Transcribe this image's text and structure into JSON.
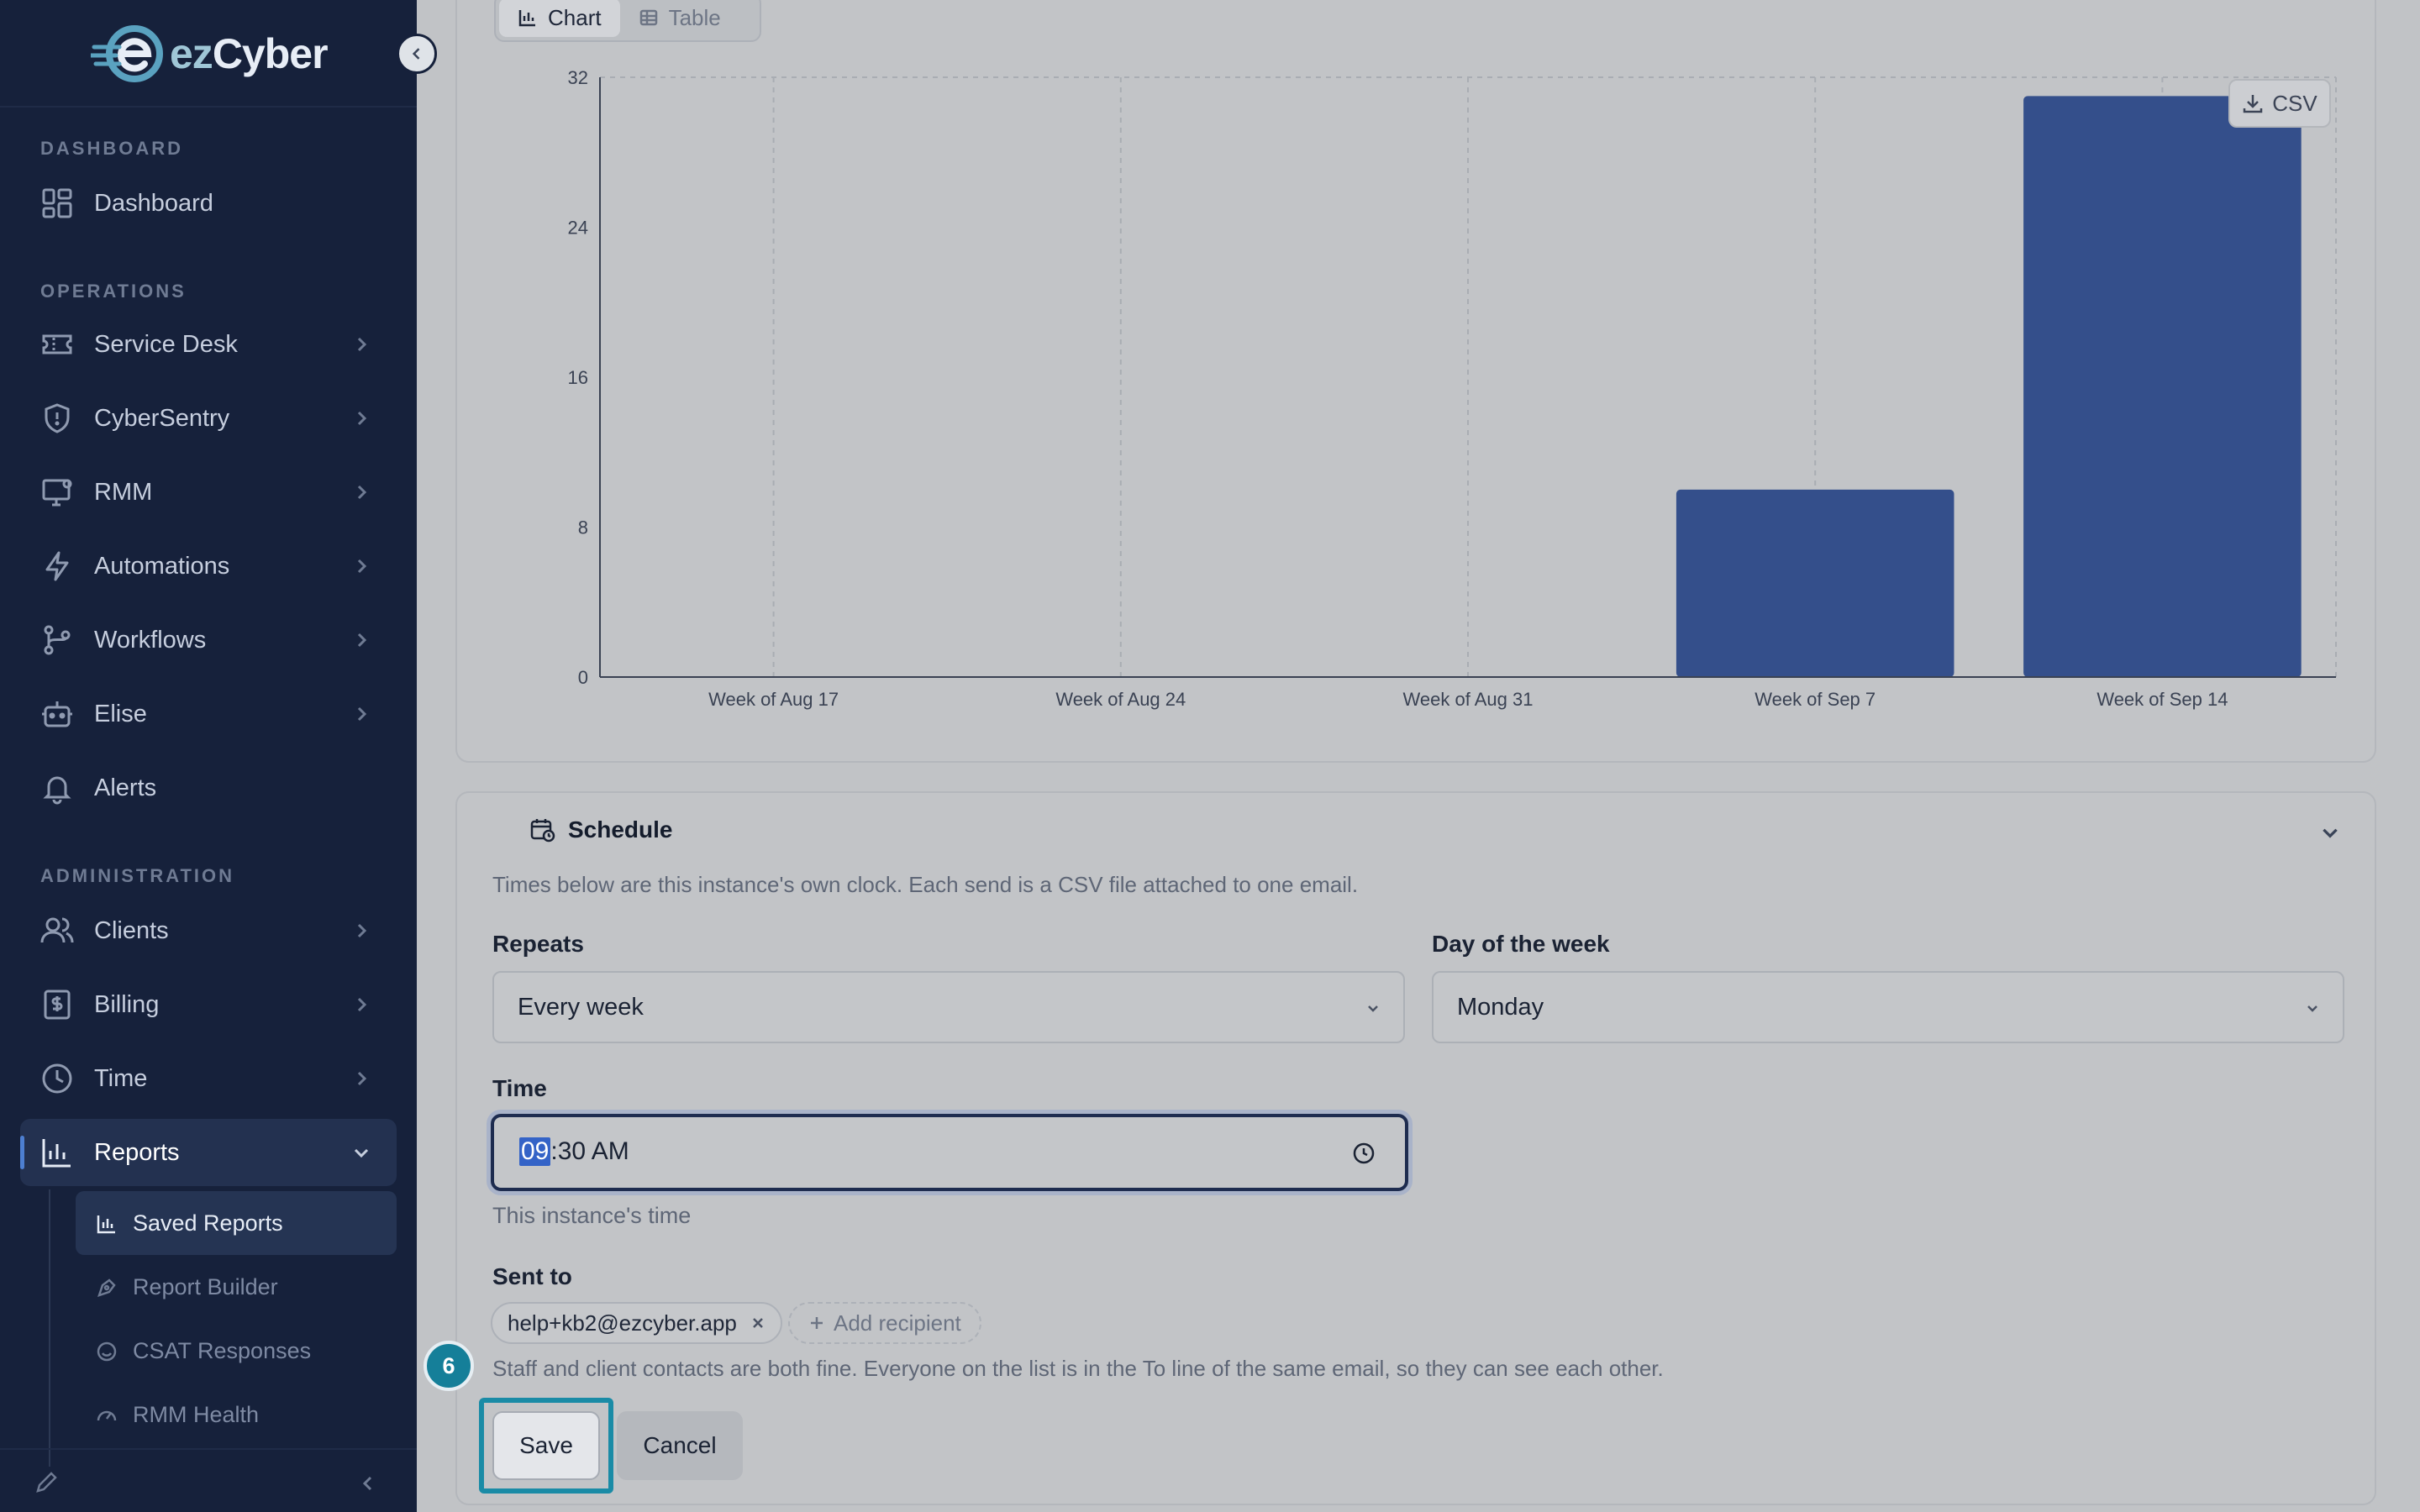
{
  "brand": {
    "name_prefix": "ez",
    "name_suffix": "Cyber"
  },
  "sidebar": {
    "sections": {
      "dashboard": "DASHBOARD",
      "operations": "OPERATIONS",
      "administration": "ADMINISTRATION"
    },
    "items": {
      "dashboard": "Dashboard",
      "service_desk": "Service Desk",
      "cybersentry": "CyberSentry",
      "rmm": "RMM",
      "automations": "Automations",
      "workflows": "Workflows",
      "elise": "Elise",
      "alerts": "Alerts",
      "clients": "Clients",
      "billing": "Billing",
      "time": "Time",
      "reports": "Reports"
    },
    "report_subitems": {
      "saved_reports": "Saved Reports",
      "report_builder": "Report Builder",
      "csat_responses": "CSAT Responses",
      "rmm_health": "RMM Health"
    }
  },
  "view_toggle": {
    "chart": "Chart",
    "table": "Table",
    "selected": "Chart"
  },
  "csv_button": "CSV",
  "chart_data": {
    "type": "bar",
    "categories": [
      "Week of Aug 17",
      "Week of Aug 24",
      "Week of Aug 31",
      "Week of Sep 7",
      "Week of Sep 14"
    ],
    "values": [
      0,
      0,
      0,
      10,
      31
    ],
    "yticks": [
      0,
      8,
      16,
      24,
      32
    ],
    "ylim": [
      0,
      32
    ],
    "bar_color": "#344f8b",
    "grid": "vertical dashed",
    "title": "",
    "xlabel": "",
    "ylabel": ""
  },
  "schedule": {
    "title": "Schedule",
    "description": "Times below are this instance's own clock. Each send is a CSV file attached to one email.",
    "repeats_label": "Repeats",
    "repeats_value": "Every week",
    "day_label": "Day of the week",
    "day_value": "Monday",
    "time_label": "Time",
    "time_hour": "09",
    "time_rest": ":30 AM",
    "time_hint": "This instance's time",
    "sent_to_label": "Sent to",
    "recipients": [
      "help+kb2@ezcyber.app"
    ],
    "add_recipient": "Add recipient",
    "recipients_hint": "Staff and client contacts are both fine. Everyone on the list is in the To line of the same email, so they can see each other.",
    "save": "Save",
    "cancel": "Cancel"
  },
  "step_badge": "6",
  "colors": {
    "sidebar_bg": "#16213b",
    "accent": "#157f99",
    "bar": "#344f8b"
  }
}
